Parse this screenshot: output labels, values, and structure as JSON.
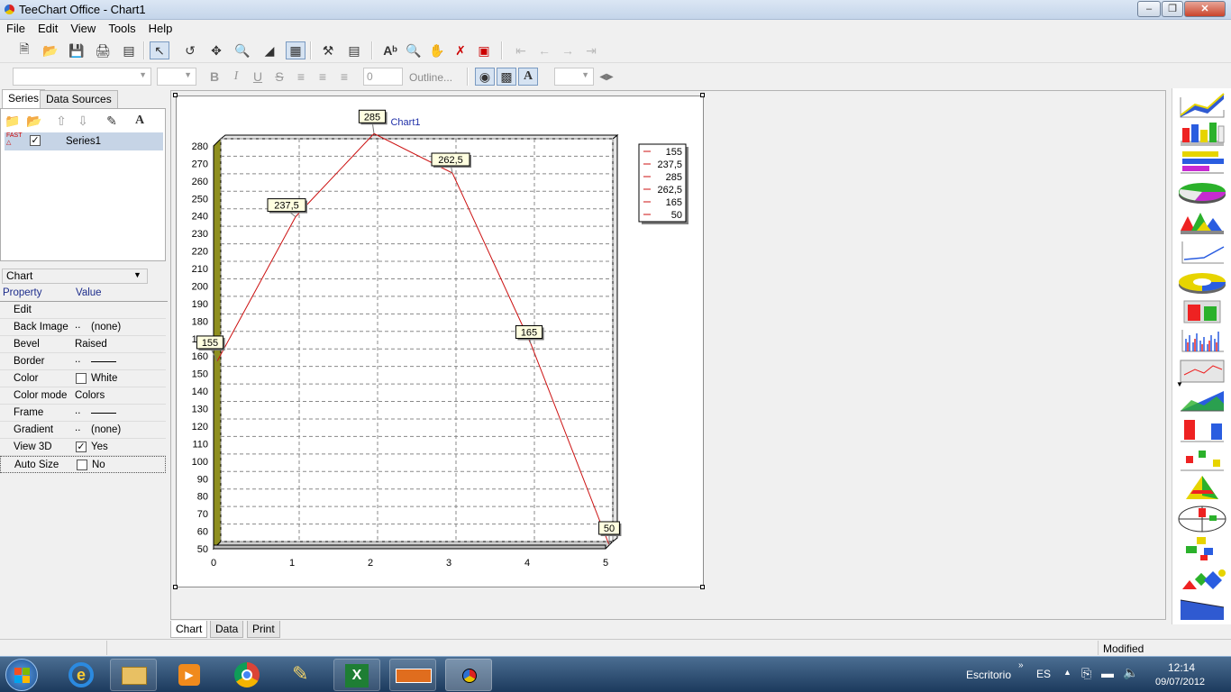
{
  "window": {
    "title": "TeeChart Office - Chart1"
  },
  "menu": [
    "File",
    "Edit",
    "View",
    "Tools",
    "Help"
  ],
  "format_toolbar": {
    "font_size_value": "0",
    "outline_label": "Outline..."
  },
  "left_tabs": [
    "Series",
    "Data Sources"
  ],
  "series_list": [
    {
      "name": "Series1",
      "checked": true
    }
  ],
  "property_selector": "Chart",
  "property_headers": {
    "property": "Property",
    "value": "Value"
  },
  "properties": [
    {
      "name": "Edit",
      "value": ""
    },
    {
      "name": "Back Image",
      "value": "(none)",
      "ellipsis": true
    },
    {
      "name": "Bevel",
      "value": "Raised"
    },
    {
      "name": "Border",
      "value": "",
      "ellipsis": true,
      "line": true
    },
    {
      "name": "Color",
      "value": "White",
      "swatch": true
    },
    {
      "name": "Color mode",
      "value": "Colors"
    },
    {
      "name": "Frame",
      "value": "",
      "ellipsis": true,
      "line": true
    },
    {
      "name": "Gradient",
      "value": "(none)",
      "ellipsis": true
    },
    {
      "name": "View 3D",
      "value": "Yes",
      "checkbox": true,
      "checked": true
    },
    {
      "name": "Auto Size",
      "value": "No",
      "checkbox": true,
      "checked": false
    }
  ],
  "bottom_tabs": [
    "Chart",
    "Data",
    "Print"
  ],
  "status": {
    "text": "Modified"
  },
  "taskbar": {
    "desktop_label": "Escritorio",
    "language": "ES",
    "time": "12:14",
    "date": "09/07/2012"
  },
  "chart_data": {
    "type": "line",
    "title": "Chart1",
    "x": [
      0,
      1,
      2,
      3,
      4,
      5
    ],
    "series": [
      {
        "name": "Series1",
        "values": [
          155,
          237.5,
          285,
          262.5,
          165,
          50
        ],
        "labels": [
          "155",
          "237,5",
          "285",
          "262,5",
          "165",
          "50"
        ],
        "color": "#cc1111"
      }
    ],
    "xlim": [
      0,
      5
    ],
    "ylim": [
      50,
      280
    ],
    "xticks": [
      "0",
      "1",
      "2",
      "3",
      "4",
      "5"
    ],
    "yticks": [
      "50",
      "60",
      "70",
      "80",
      "90",
      "100",
      "110",
      "120",
      "130",
      "140",
      "150",
      "160",
      "170",
      "180",
      "190",
      "200",
      "210",
      "220",
      "230",
      "240",
      "250",
      "260",
      "270",
      "280"
    ],
    "legend": [
      "155",
      "237,5",
      "285",
      "262,5",
      "165",
      "50"
    ],
    "legend_position": "right",
    "grid": true,
    "view3d": true,
    "wall_color": "#c8c828"
  }
}
